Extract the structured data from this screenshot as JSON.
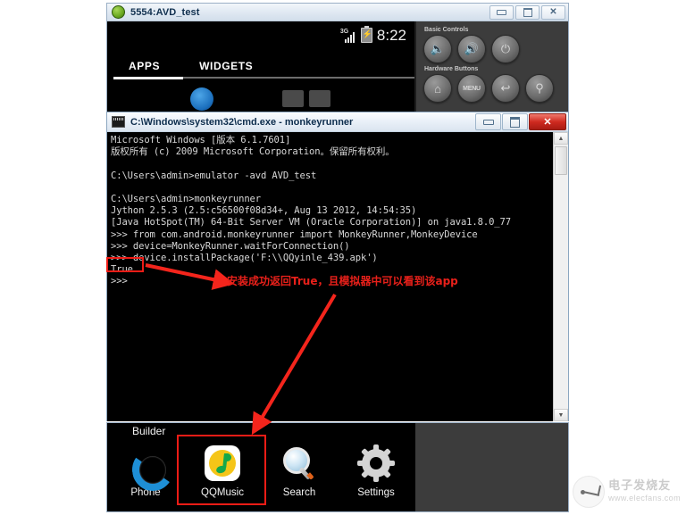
{
  "avd_window": {
    "title": "5554:AVD_test",
    "icon": "android-icon",
    "window_buttons": {
      "minimize": "–",
      "maximize": "□",
      "close": "✕"
    },
    "status_bar": {
      "network": "3G",
      "battery": "charging",
      "time": "8:22"
    },
    "tabs": [
      {
        "label": "APPS",
        "selected": true
      },
      {
        "label": "WIDGETS",
        "selected": false
      }
    ],
    "controls": {
      "basic_label": "Basic Controls",
      "basic_buttons": [
        {
          "name": "volume-down-button",
          "glyph": "🔈"
        },
        {
          "name": "volume-up-button",
          "glyph": "🔊"
        },
        {
          "name": "power-button",
          "glyph": "⏻"
        }
      ],
      "hardware_label": "Hardware Buttons",
      "hardware_buttons": [
        {
          "name": "home-button",
          "glyph": "⌂"
        },
        {
          "name": "menu-button",
          "glyph": "MENU"
        },
        {
          "name": "back-button",
          "glyph": "↩"
        },
        {
          "name": "search-button",
          "glyph": "⚲"
        }
      ]
    }
  },
  "cmd_window": {
    "title": "C:\\Windows\\system32\\cmd.exe - monkeyrunner",
    "icon": "cmd-icon",
    "window_buttons": {
      "minimize": "–",
      "maximize": "□",
      "close": "✕"
    },
    "scrollbar": {
      "up_arrow": "▲",
      "down_arrow": "▼"
    },
    "console_lines": [
      "Microsoft Windows [版本 6.1.7601]",
      "版权所有 (c) 2009 Microsoft Corporation。保留所有权利。",
      "",
      "C:\\Users\\admin>emulator -avd AVD_test",
      "",
      "C:\\Users\\admin>monkeyrunner",
      "Jython 2.5.3 (2.5:c56500f08d34+, Aug 13 2012, 14:54:35)",
      "[Java HotSpot(TM) 64-Bit Server VM (Oracle Corporation)] on java1.8.0_77",
      ">>> from com.android.monkeyrunner import MonkeyRunner,MonkeyDevice",
      ">>> device=MonkeyRunner.waitForConnection()",
      ">>> device.installPackage('F:\\\\QQyinle_439.apk')",
      "True",
      ">>>"
    ]
  },
  "bottom_emulator": {
    "builder_label": "Builder",
    "apps": [
      {
        "label": "Phone",
        "icon": "phone-icon",
        "highlighted": false
      },
      {
        "label": "QQMusic",
        "icon": "qqmusic-icon",
        "highlighted": true
      },
      {
        "label": "Search",
        "icon": "search-icon",
        "highlighted": false
      },
      {
        "label": "Settings",
        "icon": "settings-gear-icon",
        "highlighted": false
      }
    ]
  },
  "annotations": {
    "note_text": "安装成功返回True，且模拟器中可以看到该app",
    "highlight_color": "#ee1c16",
    "arrow_color": "#f4251c",
    "highlighted_value": "True",
    "highlighted_app": "QQMusic"
  },
  "watermark": {
    "cn": "电子发烧友",
    "url": "www.elecfans.com"
  }
}
